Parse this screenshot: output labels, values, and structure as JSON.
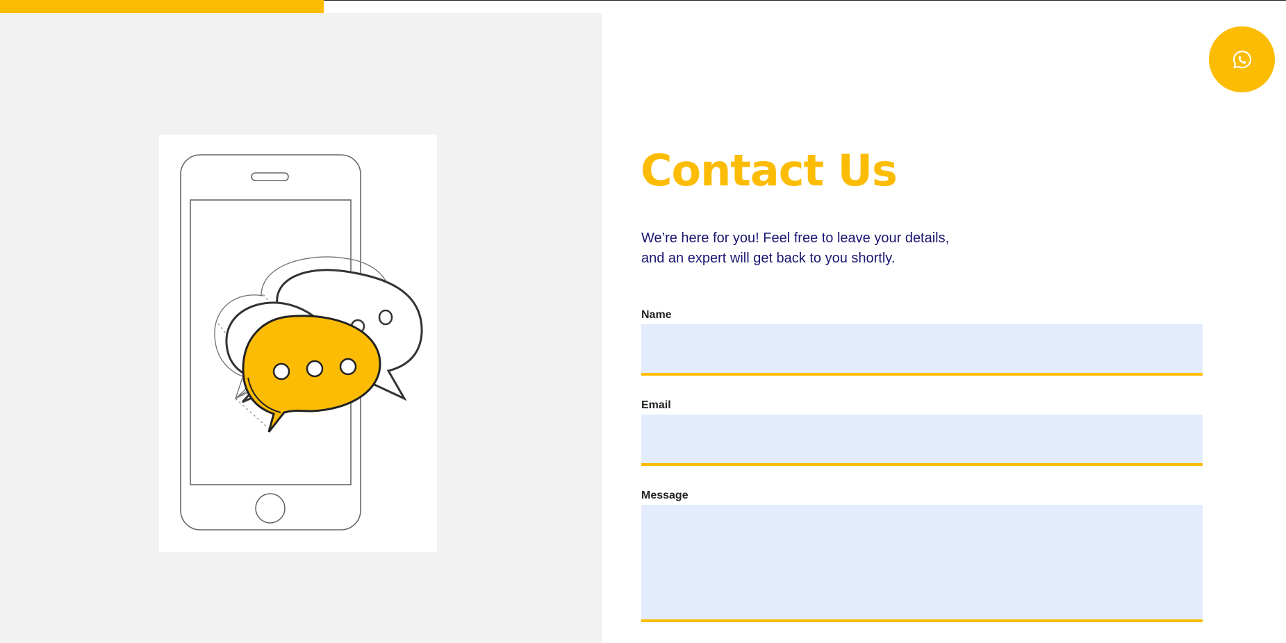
{
  "colors": {
    "accent": "#fcbc04",
    "heading": "#fcbc04",
    "body_text": "#1a1670",
    "label_text": "#222222",
    "input_background": "#e3ecfd",
    "left_panel_background": "#f2f2f2"
  },
  "scroll_progress": {
    "fraction": 0.252
  },
  "floating_action": {
    "icon": "whatsapp-icon"
  },
  "illustration": {
    "description_icon": "phone-chat-bubbles-icon"
  },
  "contact": {
    "title": "Contact Us",
    "intro_line_1": "We’re here for you! Feel free to leave your details,",
    "intro_line_2": "and an expert will get back to you shortly."
  },
  "form": {
    "name": {
      "label": "Name",
      "value": "",
      "placeholder": ""
    },
    "email": {
      "label": "Email",
      "value": "",
      "placeholder": ""
    },
    "message": {
      "label": "Message",
      "value": "",
      "placeholder": ""
    }
  }
}
